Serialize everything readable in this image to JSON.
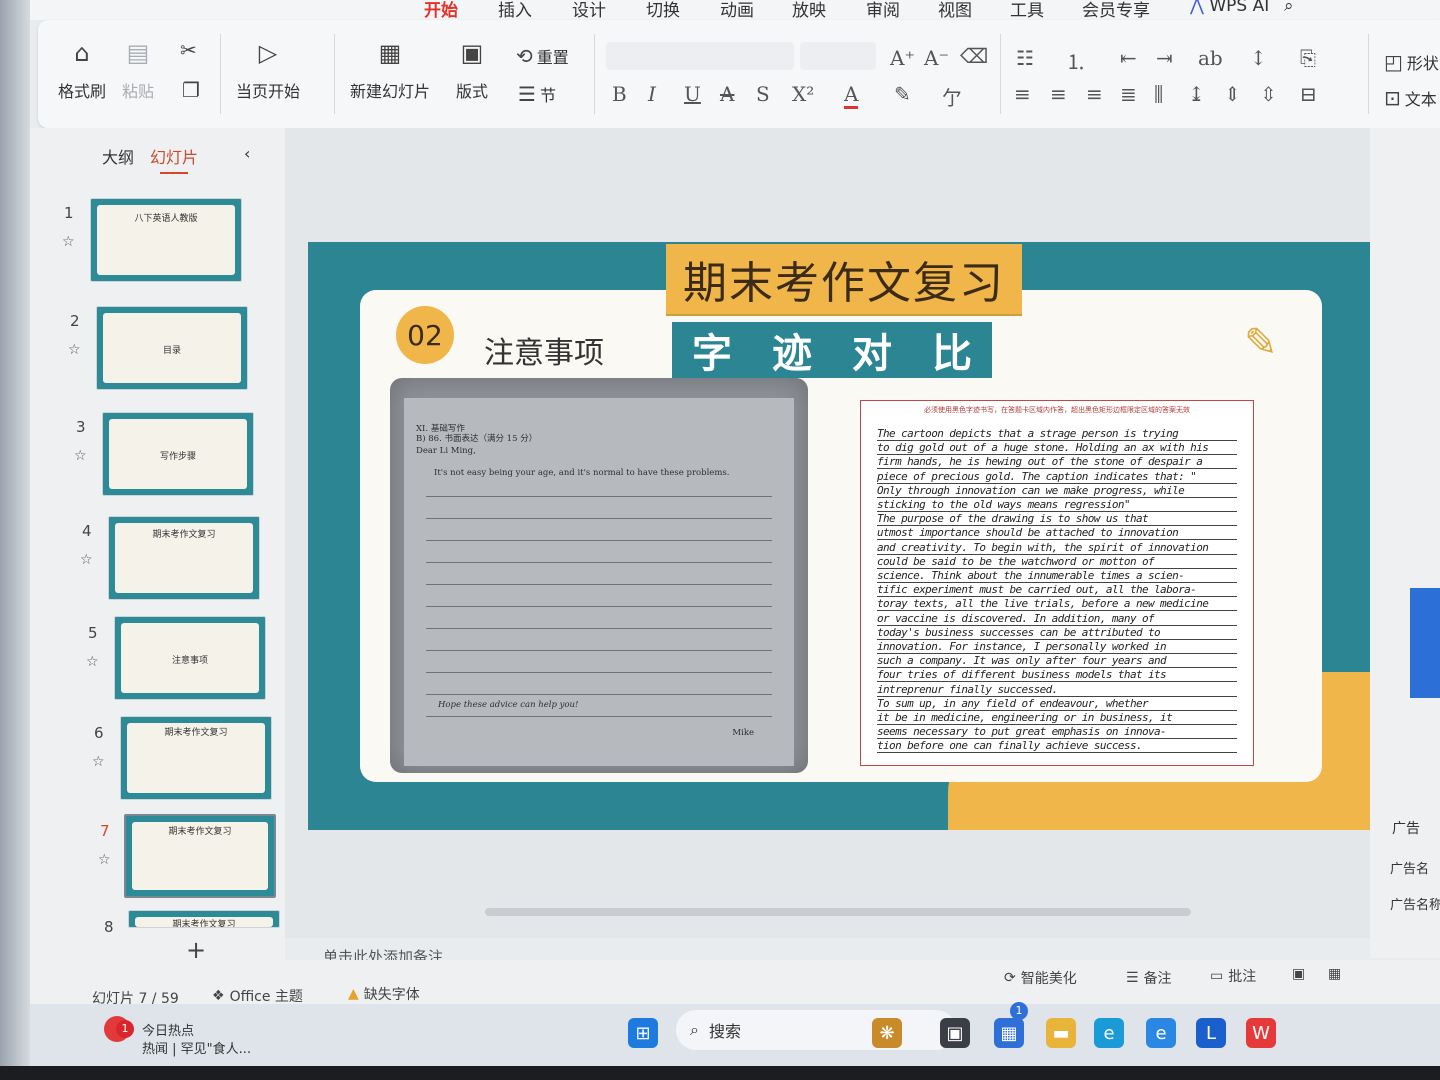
{
  "menu": {
    "tabs": [
      "开始",
      "插入",
      "设计",
      "切换",
      "动画",
      "放映",
      "审阅",
      "视图",
      "工具",
      "会员专享"
    ],
    "wps_ai": "WPS AI"
  },
  "ribbon": {
    "format_painter": "格式刷",
    "paste": "粘贴",
    "start_from_current": "当页开始",
    "new_slide": "新建幻灯片",
    "layout": "版式",
    "reset": "重置",
    "section": "节",
    "shape": "形状",
    "textbox": "文本"
  },
  "left_panel": {
    "tab_outline": "大纲",
    "tab_slides": "幻灯片",
    "slides": [
      {
        "num": "1",
        "caption": "八下英语人教版"
      },
      {
        "num": "2",
        "caption": "目录"
      },
      {
        "num": "3",
        "caption": "写作步骤"
      },
      {
        "num": "4",
        "caption": "期末考作文复习"
      },
      {
        "num": "5",
        "caption": "注意事项"
      },
      {
        "num": "6",
        "caption": "期末考作文复习"
      },
      {
        "num": "7",
        "caption": "期末考作文复习"
      },
      {
        "num": "8",
        "caption": "期末考作文复习"
      }
    ]
  },
  "slide": {
    "title": "期末考作文复习",
    "badge": "02",
    "section_title": "注意事项",
    "compare_chars": [
      "字",
      "迹",
      "对",
      "比"
    ],
    "scan": {
      "header": "XI. 基础写作",
      "task": "B) 86. 书面表达（满分 15 分）",
      "greeting": "Dear Li Ming,",
      "line1": "It's not easy being your age, and it's normal to have these problems.",
      "signature": "Mike",
      "closing": "Hope these advice can help you!"
    },
    "hand": {
      "header": "必须使用黑色字迹书写，在答题卡区域内作答，超出黑色矩形边框限定区域的答案无效",
      "lines": [
        "The cartoon depicts that a strage person is trying",
        "to dig gold out of a huge stone. Holding an ax with his",
        "firm hands, he is hewing out of the stone of despair a",
        "piece of precious gold. The caption indicates that: \"",
        "Only through innovation can we make progress, while",
        "sticking to the old ways means regression\"",
        "The purpose of the drawing is to show us that",
        "utmost importance should be attached to innovation",
        "and creativity. To begin with, the spirit of innovation",
        "could be said to be the watchword or motton of",
        "science. Think about the innumerable times a scien-",
        "tific experiment must be carried out, all the labora-",
        "toray texts, all the live trials, before a new medicine",
        "or vaccine is discovered. In addition, many of",
        "today's business successes can be attributed to",
        "innovation. For instance, I personally worked in",
        "such a company. It was only after four years and",
        "four tries of different business models that its",
        "intreprenur finally successed.",
        "To sum up, in any field of endeavour, whether",
        "it be in medicine, engineering or in business, it",
        "seems necessary to put great emphasis on innova-",
        "tion before one can finally achieve success."
      ]
    }
  },
  "notes_placeholder": "单击此处添加备注",
  "status": {
    "slide_counter": "幻灯片 7 / 59",
    "theme": "Office 主题",
    "missing_font": "缺失字体",
    "beautify": "智能美化",
    "notes": "备注",
    "comments": "批注"
  },
  "right_pane": {
    "ad1": "广告",
    "ad2": "广告名",
    "ad3": "广告名称"
  },
  "taskbar": {
    "news_title": "今日热点",
    "news_sub": "热闻 | 罕见\"食人...",
    "news_badge": "1",
    "search": "搜索",
    "store_badge": "1"
  },
  "colors": {
    "accent_red": "#e2332b",
    "slide_teal": "#2c8593",
    "slide_gold": "#f0b64a"
  }
}
